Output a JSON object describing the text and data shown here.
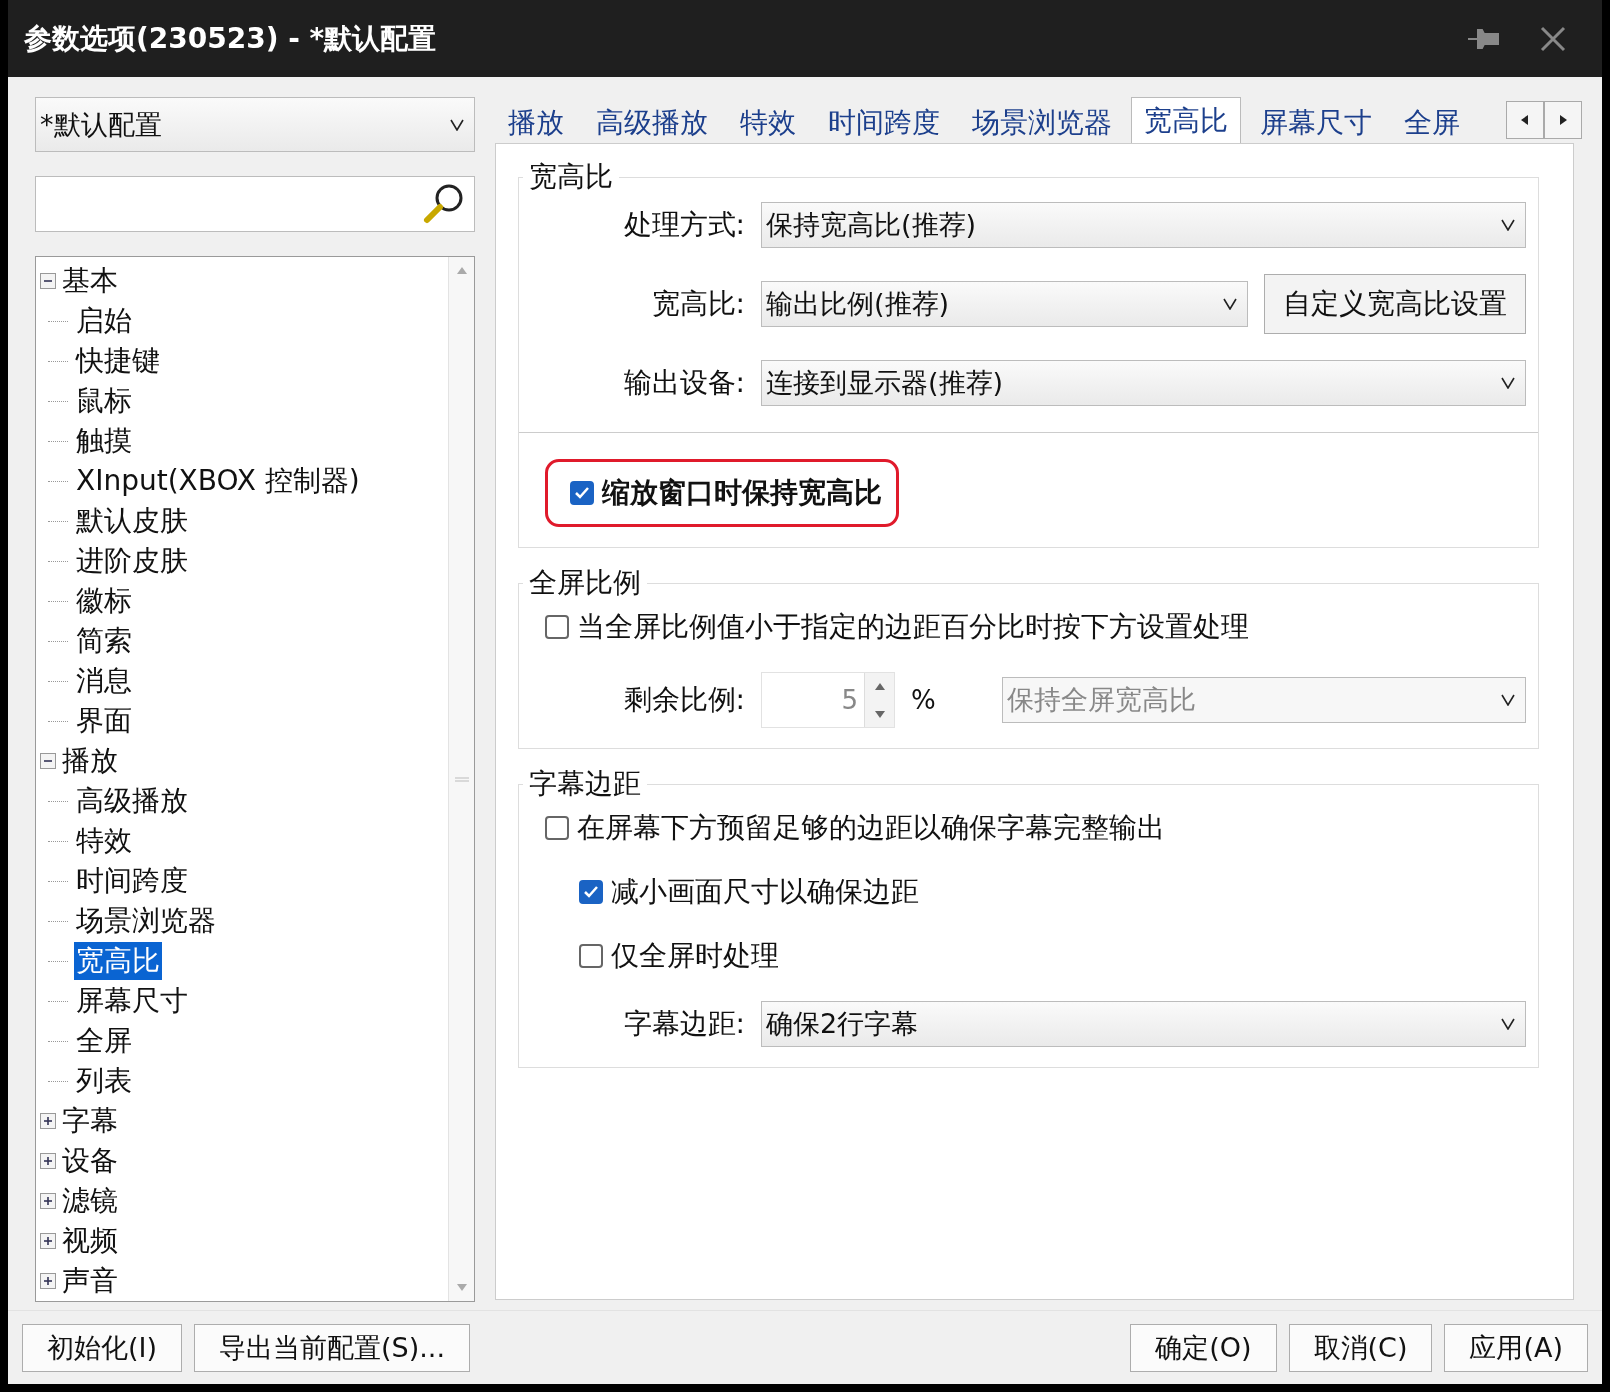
{
  "window": {
    "title": "参数选项(230523) - *默认配置"
  },
  "profile_select": {
    "value": "*默认配置"
  },
  "tree": [
    {
      "label": "基本",
      "expanded": true,
      "selected": false,
      "children": [
        {
          "label": "启始",
          "selected": false
        },
        {
          "label": "快捷键",
          "selected": false
        },
        {
          "label": "鼠标",
          "selected": false
        },
        {
          "label": "触摸",
          "selected": false
        },
        {
          "label": "XInput(XBOX 控制器)",
          "selected": false
        },
        {
          "label": "默认皮肤",
          "selected": false
        },
        {
          "label": "进阶皮肤",
          "selected": false
        },
        {
          "label": "徽标",
          "selected": false
        },
        {
          "label": "简索",
          "selected": false
        },
        {
          "label": "消息",
          "selected": false
        },
        {
          "label": "界面",
          "selected": false
        }
      ]
    },
    {
      "label": "播放",
      "expanded": true,
      "selected": false,
      "children": [
        {
          "label": "高级播放",
          "selected": false
        },
        {
          "label": "特效",
          "selected": false
        },
        {
          "label": "时间跨度",
          "selected": false
        },
        {
          "label": "场景浏览器",
          "selected": false
        },
        {
          "label": "宽高比",
          "selected": true
        },
        {
          "label": "屏幕尺寸",
          "selected": false
        },
        {
          "label": "全屏",
          "selected": false
        },
        {
          "label": "列表",
          "selected": false
        }
      ]
    },
    {
      "label": "字幕",
      "expanded": false,
      "selected": false
    },
    {
      "label": "设备",
      "expanded": false,
      "selected": false
    },
    {
      "label": "滤镜",
      "expanded": false,
      "selected": false
    },
    {
      "label": "视频",
      "expanded": false,
      "selected": false
    },
    {
      "label": "声音",
      "expanded": false,
      "selected": false
    }
  ],
  "tabs": [
    {
      "label": "播放",
      "selected": false
    },
    {
      "label": "高级播放",
      "selected": false
    },
    {
      "label": "特效",
      "selected": false
    },
    {
      "label": "时间跨度",
      "selected": false
    },
    {
      "label": "场景浏览器",
      "selected": false
    },
    {
      "label": "宽高比",
      "selected": true
    },
    {
      "label": "屏幕尺寸",
      "selected": false
    },
    {
      "label": "全屏",
      "selected": false
    }
  ],
  "groups": [
    {
      "title": "宽高比",
      "rows": [
        {
          "kind": "select",
          "label": "处理方式:",
          "value": "保持宽高比(推荐)",
          "disabled": false
        },
        {
          "kind": "select",
          "label": "宽高比:",
          "value": "输出比例(推荐)",
          "disabled": false,
          "button": "自定义宽高比设置"
        },
        {
          "kind": "select",
          "label": "输出设备:",
          "value": "连接到显示器(推荐)",
          "disabled": false
        },
        {
          "kind": "divider"
        },
        {
          "kind": "checkbox",
          "label": "缩放窗口时保持宽高比",
          "checked": true,
          "highlighted": true
        }
      ]
    },
    {
      "title": "全屏比例",
      "rows": [
        {
          "kind": "checkbox",
          "label": "当全屏比例值小于指定的边距百分比时按下方设置处理",
          "checked": false,
          "highlighted": false
        },
        {
          "kind": "spin",
          "label": "剩余比例:",
          "value": "5",
          "unit": "%",
          "select": "保持全屏宽高比",
          "disabled": true
        }
      ]
    },
    {
      "title": "字幕边距",
      "rows": [
        {
          "kind": "checkbox",
          "label": "在屏幕下方预留足够的边距以确保字幕完整输出",
          "checked": false,
          "highlighted": false,
          "children": [
            {
              "label": "减小画面尺寸以确保边距",
              "checked": true,
              "highlighted": false
            },
            {
              "label": "仅全屏时处理",
              "checked": false,
              "highlighted": false
            }
          ]
        },
        {
          "kind": "select",
          "label": "字幕边距:",
          "value": "确保2行字幕",
          "disabled": false
        }
      ]
    }
  ],
  "footer_left": [
    "初始化(I)",
    "导出当前配置(S)..."
  ],
  "footer_right": [
    "确定(O)",
    "取消(C)",
    "应用(A)"
  ]
}
